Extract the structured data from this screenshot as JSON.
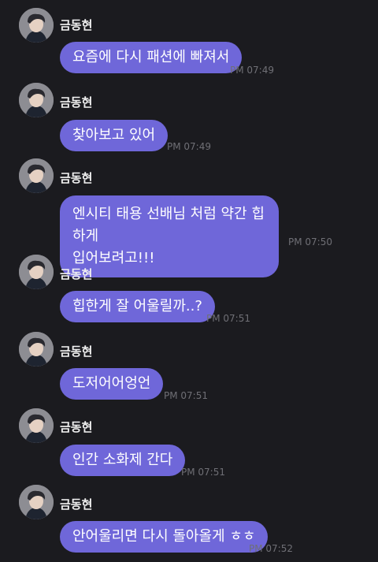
{
  "chat": {
    "messages": [
      {
        "sender": "금동현",
        "text": "요즘에 다시 패션에 빠져서",
        "time": "PM 07:49"
      },
      {
        "sender": "금동현",
        "text": "찾아보고 있어",
        "time": "PM 07:49"
      },
      {
        "sender": "금동현",
        "text_line1": "엔시티 태용 선배님 처럼 약간 힙하게",
        "text_line2": "입어보려고!!!",
        "time": "PM 07:50"
      },
      {
        "sender": "금동현",
        "text": "힙한게 잘 어울릴까..?",
        "time": "PM 07:51"
      },
      {
        "sender": "금동현",
        "text": "도저어어엉언",
        "time": "PM 07:51"
      },
      {
        "sender": "금동현",
        "text": "인간 소화제 간다",
        "time": "PM 07:51"
      },
      {
        "sender": "금동현",
        "text": "안어울리면 다시 돌아올게 ㅎㅎ",
        "time": "PM 07:52"
      }
    ]
  },
  "colors": {
    "background": "#1b1b1f",
    "bubble": "#6f67d9",
    "name": "#f1f1f1",
    "time": "#6f6f75"
  },
  "avatar_icon": "profile-photo-icon"
}
